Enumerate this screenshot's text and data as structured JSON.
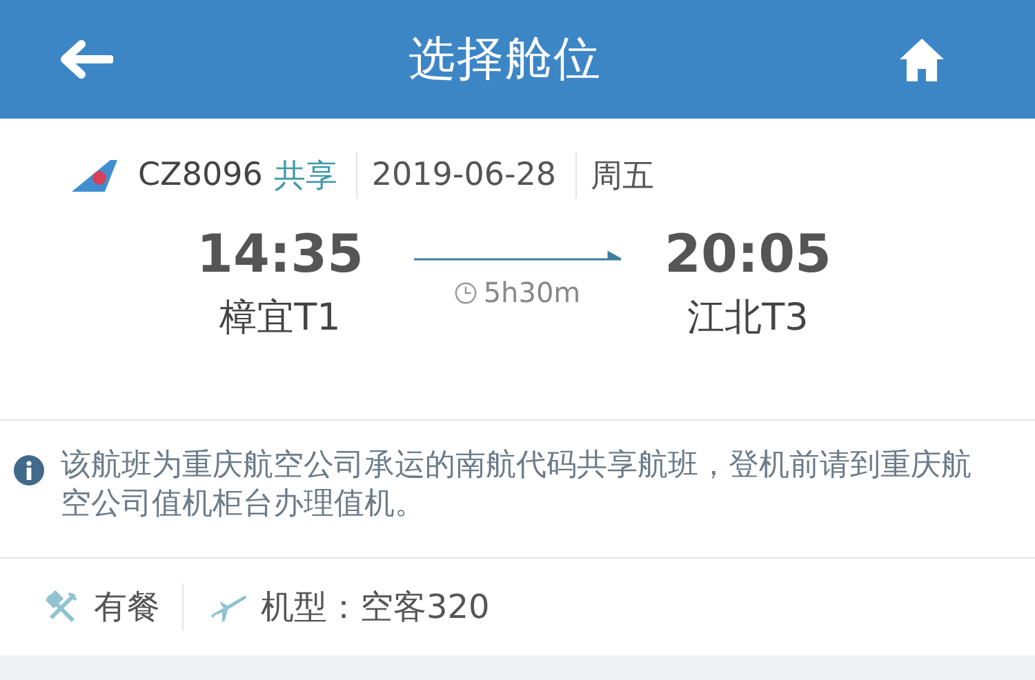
{
  "header": {
    "title": "选择舱位"
  },
  "flight": {
    "number": "CZ8096",
    "share_tag": "共享",
    "date": "2019-06-28",
    "weekday": "周五",
    "depart": {
      "time": "14:35",
      "airport": "樟宜T1"
    },
    "arrive": {
      "time": "20:05",
      "airport": "江北T3"
    },
    "duration": "5h30m"
  },
  "notice": "该航班为重庆航空公司承运的南航代码共享航班，登机前请到重庆航空公司值机柜台办理值机。",
  "amenities": [
    {
      "kind": "meal",
      "label": "有餐"
    },
    {
      "kind": "aircraft",
      "label": "机型：空客320"
    }
  ]
}
